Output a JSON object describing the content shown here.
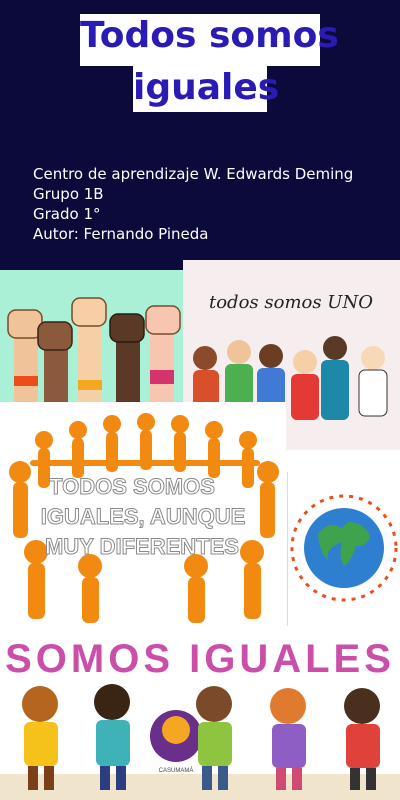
{
  "header": {
    "title_line1": "Todos somos",
    "title_line2": "iguales",
    "info": {
      "school": "Centro de aprendizaje W. Edwards Deming",
      "group": "Grupo 1B",
      "grade": "Grado 1°",
      "author": "Autor: Fernando Pineda"
    }
  },
  "images": {
    "collage_2": {
      "caption": "todos somos UNO"
    },
    "collage_3": {
      "text_line1": "TODOS SOMOS",
      "text_line2": "IGUALES, AUNQUE",
      "text_line3": "MUY DIFERENTES"
    },
    "collage_5": {
      "banner": "SOMOS IGUALES",
      "logo_text": "CASUMAMÁ"
    }
  },
  "colors": {
    "header_bg": "#0c0a3a",
    "title_text": "#2a1bb5",
    "info_text": "#ffffff"
  }
}
